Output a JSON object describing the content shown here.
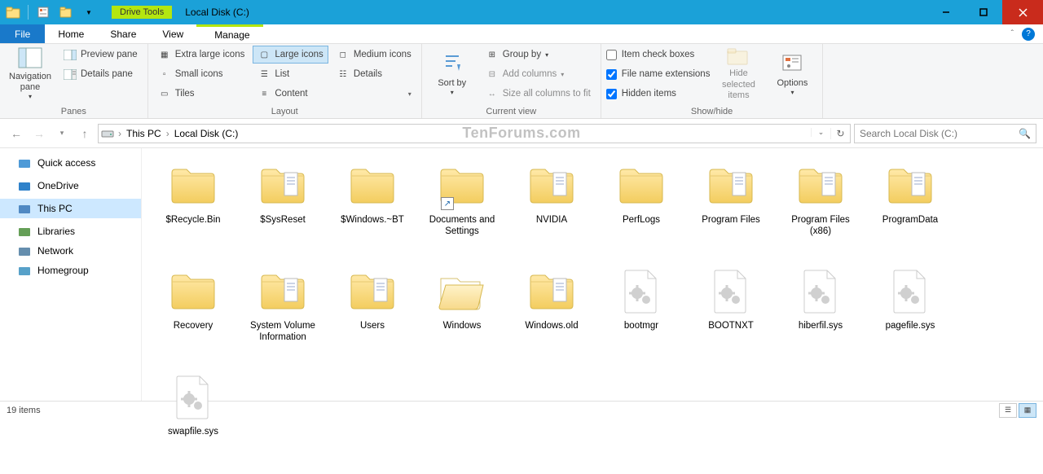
{
  "title": "Local Disk (C:)",
  "drive_tools_label": "Drive Tools",
  "tabs": {
    "file": "File",
    "home": "Home",
    "share": "Share",
    "view": "View",
    "manage": "Manage"
  },
  "ribbon": {
    "panes": {
      "navigation": "Navigation pane",
      "preview": "Preview pane",
      "details": "Details pane",
      "group": "Panes"
    },
    "layout": {
      "extra_large": "Extra large icons",
      "large": "Large icons",
      "medium": "Medium icons",
      "small": "Small icons",
      "list": "List",
      "details": "Details",
      "tiles": "Tiles",
      "content": "Content",
      "group": "Layout"
    },
    "current_view": {
      "sort_by": "Sort by",
      "group_by": "Group by",
      "add_columns": "Add columns",
      "size_all": "Size all columns to fit",
      "group": "Current view"
    },
    "show_hide": {
      "item_check": "Item check boxes",
      "file_ext": "File name extensions",
      "hidden": "Hidden items",
      "hide_selected": "Hide selected items",
      "options": "Options",
      "group": "Show/hide"
    }
  },
  "breadcrumb": {
    "root": "This PC",
    "child": "Local Disk (C:)"
  },
  "search_placeholder": "Search Local Disk (C:)",
  "watermark": "TenForums.com",
  "sidebar": [
    {
      "label": "Quick access",
      "color": "#2f88d0"
    },
    {
      "label": "OneDrive",
      "color": "#0a6cc1"
    },
    {
      "label": "This PC",
      "color": "#3a78b8",
      "selected": true
    },
    {
      "label": "Libraries",
      "color": "#4a8e3a"
    },
    {
      "label": "Network",
      "color": "#4a7aa0"
    },
    {
      "label": "Homegroup",
      "color": "#3a90c0"
    }
  ],
  "items": [
    {
      "label": "$Recycle.Bin",
      "type": "folder"
    },
    {
      "label": "$SysReset",
      "type": "folder-docs"
    },
    {
      "label": "$Windows.~BT",
      "type": "folder"
    },
    {
      "label": "Documents and Settings",
      "type": "folder",
      "shortcut": true
    },
    {
      "label": "NVIDIA",
      "type": "folder-docs"
    },
    {
      "label": "PerfLogs",
      "type": "folder"
    },
    {
      "label": "Program Files",
      "type": "folder-docs"
    },
    {
      "label": "Program Files (x86)",
      "type": "folder-docs"
    },
    {
      "label": "ProgramData",
      "type": "folder-docs"
    },
    {
      "label": "Recovery",
      "type": "folder"
    },
    {
      "label": "System Volume Information",
      "type": "folder-docs"
    },
    {
      "label": "Users",
      "type": "folder-docs"
    },
    {
      "label": "Windows",
      "type": "folder-open"
    },
    {
      "label": "Windows.old",
      "type": "folder-docs"
    },
    {
      "label": "bootmgr",
      "type": "sysfile"
    },
    {
      "label": "BOOTNXT",
      "type": "sysfile"
    },
    {
      "label": "hiberfil.sys",
      "type": "sysfile"
    },
    {
      "label": "pagefile.sys",
      "type": "sysfile"
    },
    {
      "label": "swapfile.sys",
      "type": "sysfile"
    }
  ],
  "status": {
    "count": "19 items"
  }
}
